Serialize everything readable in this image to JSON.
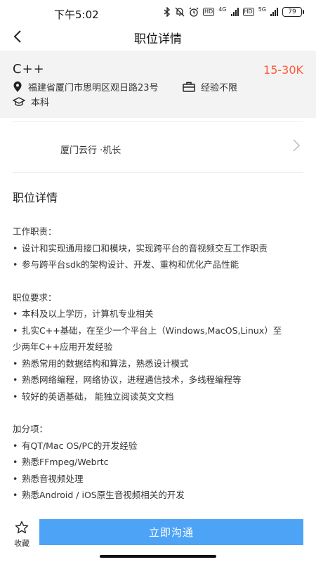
{
  "status_bar": {
    "time": "下午5:02",
    "net1": "4G",
    "net2": "5G",
    "hd": "HD",
    "battery": "79"
  },
  "nav": {
    "title": "职位详情"
  },
  "job": {
    "title": "C++",
    "salary": "15-30K",
    "address": "福建省厦门市思明区观日路23号",
    "experience": "经验不限",
    "education": "本科"
  },
  "company": {
    "text": "厦门云行 ·机长"
  },
  "details": {
    "section_title": "职位详情",
    "responsibilities_heading": "工作职责：",
    "responsibilities": [
      "设计和实现通用接口和模块，实现跨平台的音视频交互工作职责",
      "参与跨平台sdk的架构设计、开发、重构和优化产品性能"
    ],
    "requirements_heading": "职位要求：",
    "requirements_1": "本科及以上学历，计算机专业相关",
    "requirements_2_line1": "扎实C++基础，在至少一个平台上（Windows,MacOS,Linux）至",
    "requirements_2_line2": "少两年C++应用开发经验",
    "requirements_3": "熟悉常用的数据结构和算法，熟悉设计模式",
    "requirements_4": "熟悉网络编程，网络协议，进程通信技术，多线程编程等",
    "requirements_5": "较好的英语基础， 能独立阅读英文文档",
    "bonus_heading": "加分项：",
    "bonus": [
      "有QT/Mac OS/PC的开发经验",
      "熟悉FFmpeg/Webrtc",
      "熟悉音视频处理",
      "熟悉Android / iOS原生音视频相关的开发"
    ]
  },
  "bottom": {
    "favorite_label": "收藏",
    "chat_label": "立即沟通"
  },
  "colors": {
    "salary": "#ff5a3c",
    "primary_button": "#4da3f5"
  }
}
